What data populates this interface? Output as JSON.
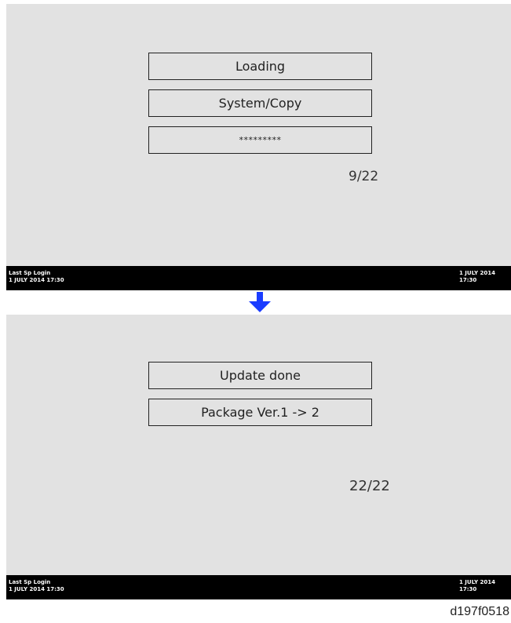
{
  "screen1": {
    "box1": "Loading",
    "box2": "System/Copy",
    "box3": "*********",
    "progress": "9/22",
    "status_left_line1": "Last Sp Login",
    "status_left_line2": "1 JULY 2014 17:30",
    "status_right_line1": "1 JULY 2014",
    "status_right_line2": "17:30"
  },
  "screen2": {
    "box1": "Update done",
    "box2": "Package Ver.1 -> 2",
    "progress": "22/22",
    "status_left_line1": "Last Sp Login",
    "status_left_line2": "1 JULY 2014 17:30",
    "status_right_line1": "1 JULY 2014",
    "status_right_line2": "17:30"
  },
  "arrow_icon": "down-arrow-icon",
  "colors": {
    "screen_bg": "#e2e2e2",
    "statusbar_bg": "#000000",
    "arrow": "#1a3cff"
  },
  "figure_id": "d197f0518"
}
